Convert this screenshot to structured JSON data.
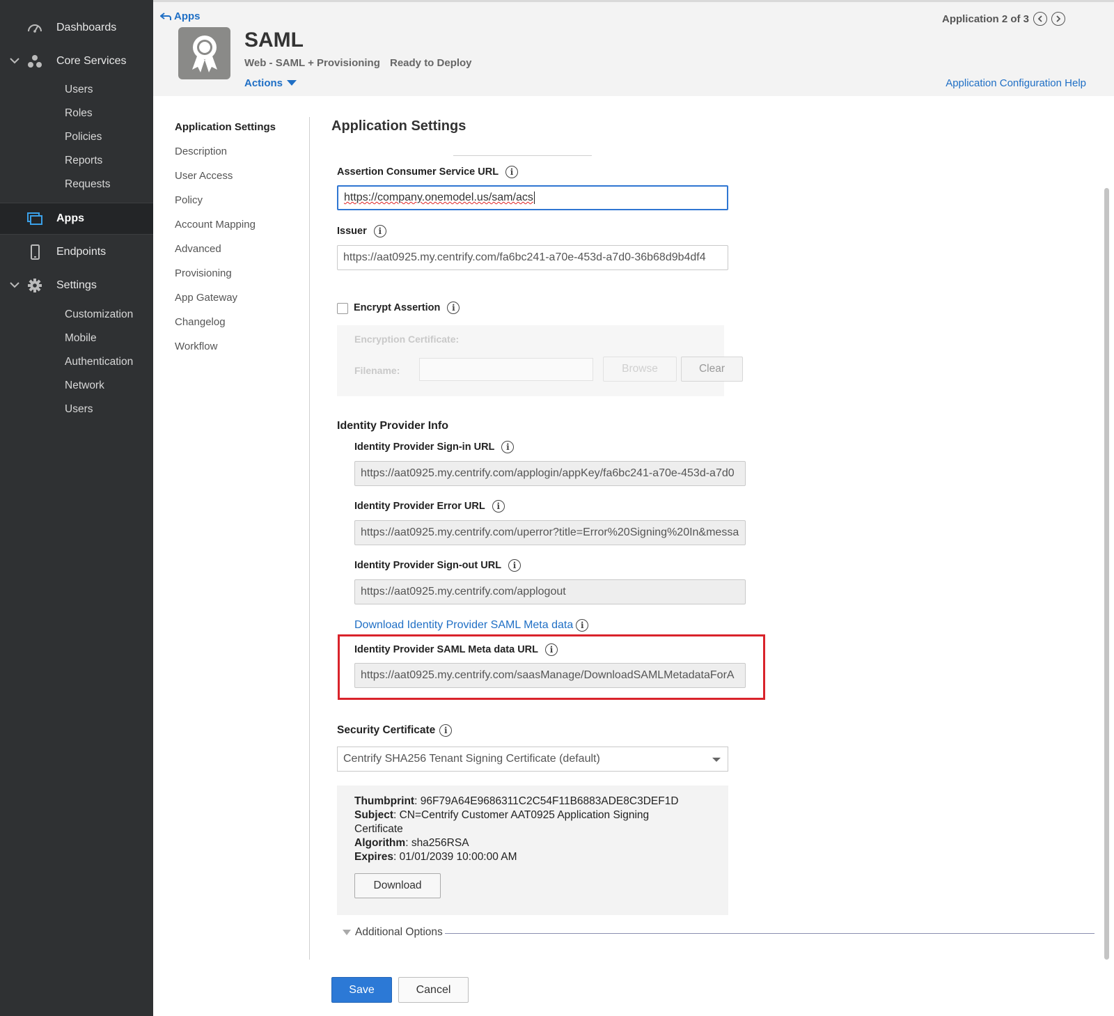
{
  "sidebar": {
    "groups": [
      {
        "label": "Dashboards",
        "icon": "gauge-icon"
      },
      {
        "label": "Core Services",
        "icon": "core-services-icon",
        "subitems": [
          "Users",
          "Roles",
          "Policies",
          "Reports",
          "Requests"
        ]
      },
      {
        "label": "Apps",
        "icon": "apps-icon"
      },
      {
        "label": "Endpoints",
        "icon": "mobile-device-icon"
      },
      {
        "label": "Settings",
        "icon": "gear-icon",
        "subitems": [
          "Customization",
          "Mobile",
          "Authentication",
          "Network",
          "Users"
        ]
      }
    ],
    "active": "Apps"
  },
  "header": {
    "back_label": "Apps",
    "app_title": "SAML",
    "app_type": "Web - SAML + Provisioning",
    "app_status": "Ready to Deploy",
    "actions_label": "Actions",
    "pager_text": "Application 2 of 3",
    "config_help": "Application Configuration Help"
  },
  "section_nav": {
    "items": [
      "Application Settings",
      "Description",
      "User Access",
      "Policy",
      "Account Mapping",
      "Advanced",
      "Provisioning",
      "App Gateway",
      "Changelog",
      "Workflow"
    ],
    "active": "Application Settings"
  },
  "main": {
    "title": "Application Settings",
    "acs_url": {
      "label": "Assertion Consumer Service URL",
      "value": "https://company.onemodel.us/sam/acs"
    },
    "issuer": {
      "label": "Issuer",
      "value": "https://aat0925.my.centrify.com/fa6bc241-a70e-453d-a7d0-36b68d9b4df4"
    },
    "encrypt": {
      "label": "Encrypt Assertion",
      "checked": false,
      "cert_label": "Encryption Certificate:",
      "filename_label": "Filename:",
      "browse_label": "Browse",
      "clear_label": "Clear"
    },
    "idp": {
      "heading": "Identity Provider Info",
      "signin": {
        "label": "Identity Provider Sign-in URL",
        "value": "https://aat0925.my.centrify.com/applogin/appKey/fa6bc241-a70e-453d-a7d0"
      },
      "error": {
        "label": "Identity Provider Error URL",
        "value": "https://aat0925.my.centrify.com/uperror?title=Error%20Signing%20In&messa"
      },
      "signout": {
        "label": "Identity Provider Sign-out URL",
        "value": "https://aat0925.my.centrify.com/applogout"
      },
      "download_link": "Download Identity Provider SAML Meta data",
      "metadata": {
        "label": "Identity Provider SAML Meta data URL",
        "value": "https://aat0925.my.centrify.com/saasManage/DownloadSAMLMetadataForA"
      }
    },
    "security": {
      "label": "Security Certificate",
      "selected": "Centrify SHA256 Tenant Signing Certificate (default)",
      "thumbprint_label": "Thumbprint",
      "thumbprint": "96F79A64E9686311C2C54F11B6883ADE8C3DEF1D",
      "subject_label": "Subject",
      "subject": "CN=Centrify Customer AAT0925 Application Signing",
      "subject_cont": "Certificate",
      "algorithm_label": "Algorithm",
      "algorithm": "sha256RSA",
      "expires_label": "Expires",
      "expires": "01/01/2039 10:00:00 AM",
      "download_label": "Download"
    },
    "additional_options": "Additional Options",
    "save_label": "Save",
    "cancel_label": "Cancel"
  },
  "colors": {
    "sidebar_bg": "#2f3133",
    "accent": "#2c79d6",
    "link": "#1f6fc5",
    "highlight": "#d9232b"
  }
}
